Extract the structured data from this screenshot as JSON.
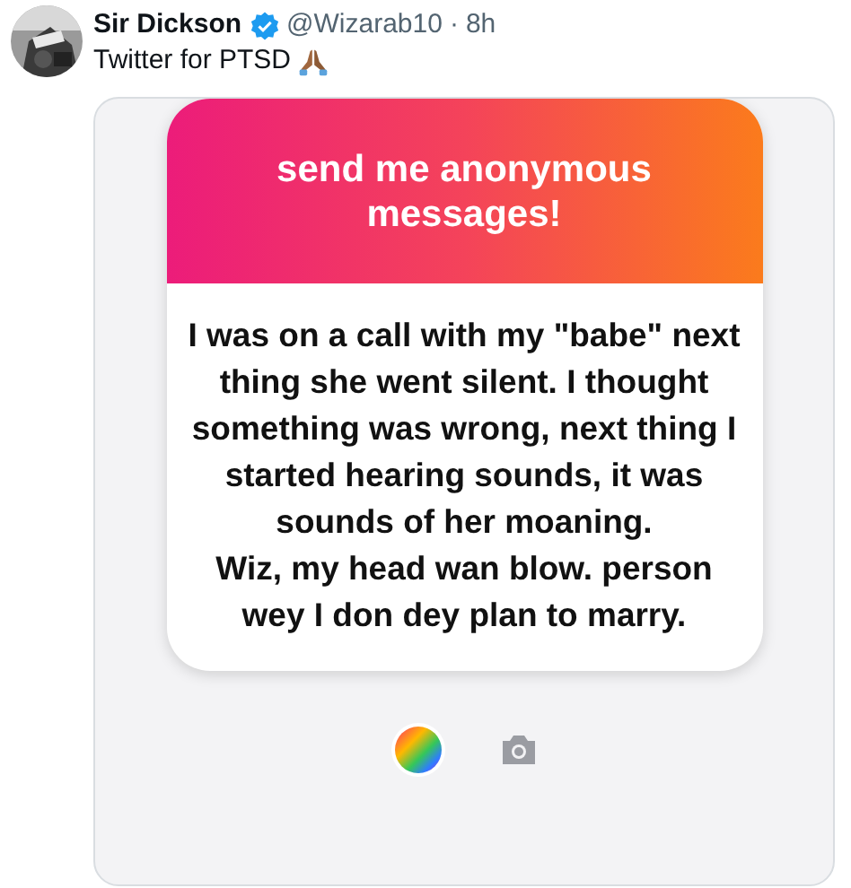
{
  "tweet": {
    "author": "Sir Dickson",
    "verified": true,
    "handle": "@Wizarab10",
    "separator": "·",
    "time": "8h",
    "text": "Twitter for PTSD"
  },
  "media": {
    "header": "send me anonymous messages!",
    "message": "I was on a call with my \"babe\" next thing she went silent. I thought something was wrong, next thing I started hearing sounds, it was sounds of her moaning.\nWiz, my head wan blow. person wey I don dey plan to marry."
  }
}
